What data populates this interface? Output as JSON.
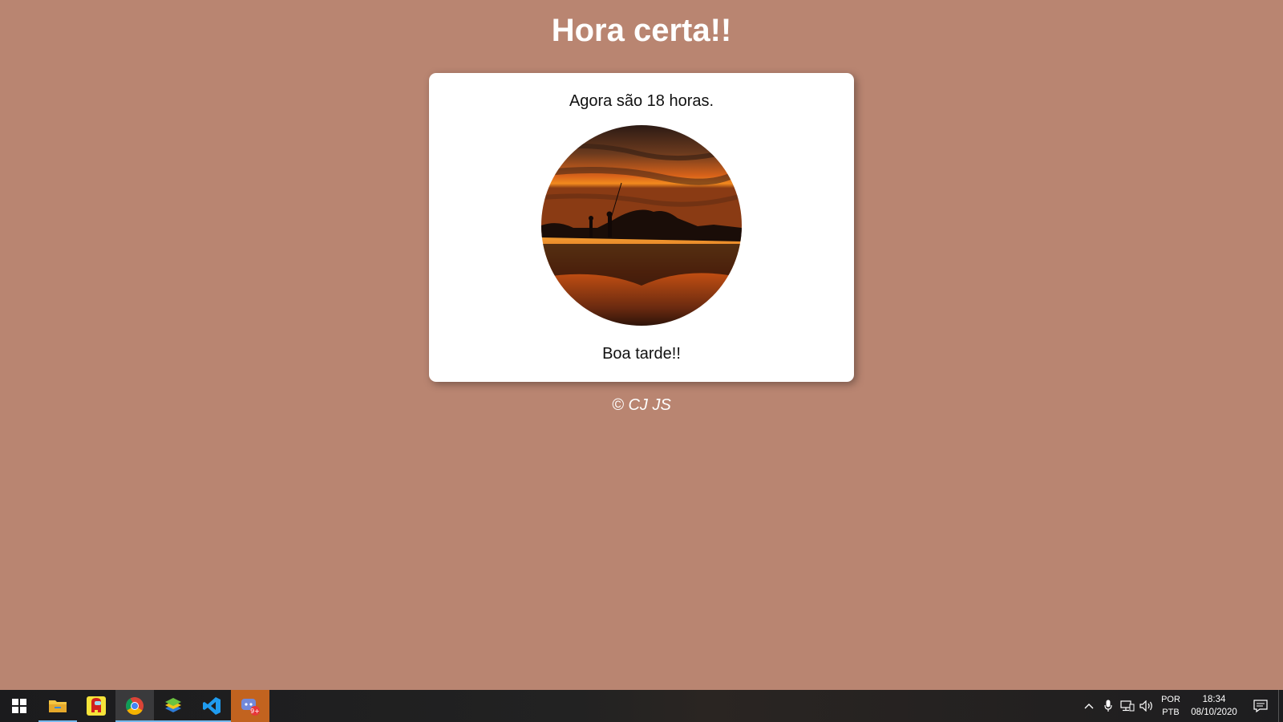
{
  "header": {
    "title": "Hora certa!!"
  },
  "card": {
    "message": "Agora são 18 horas.",
    "greeting": "Boa tarde!!"
  },
  "footer": {
    "text": "© CJ JS"
  },
  "colors": {
    "background": "#b98571",
    "card": "#ffffff",
    "taskbar": "#1f1f21"
  },
  "taskbar": {
    "apps": [
      {
        "icon": "windows-start-icon"
      },
      {
        "icon": "file-explorer-icon"
      },
      {
        "icon": "among-us-icon"
      },
      {
        "icon": "chrome-icon"
      },
      {
        "icon": "bluestacks-icon"
      },
      {
        "icon": "vscode-icon"
      },
      {
        "icon": "discord-icon",
        "badge": "9+"
      }
    ],
    "tray": {
      "language_line1": "POR",
      "language_line2": "PTB",
      "time": "18:34",
      "date": "08/10/2020"
    }
  }
}
